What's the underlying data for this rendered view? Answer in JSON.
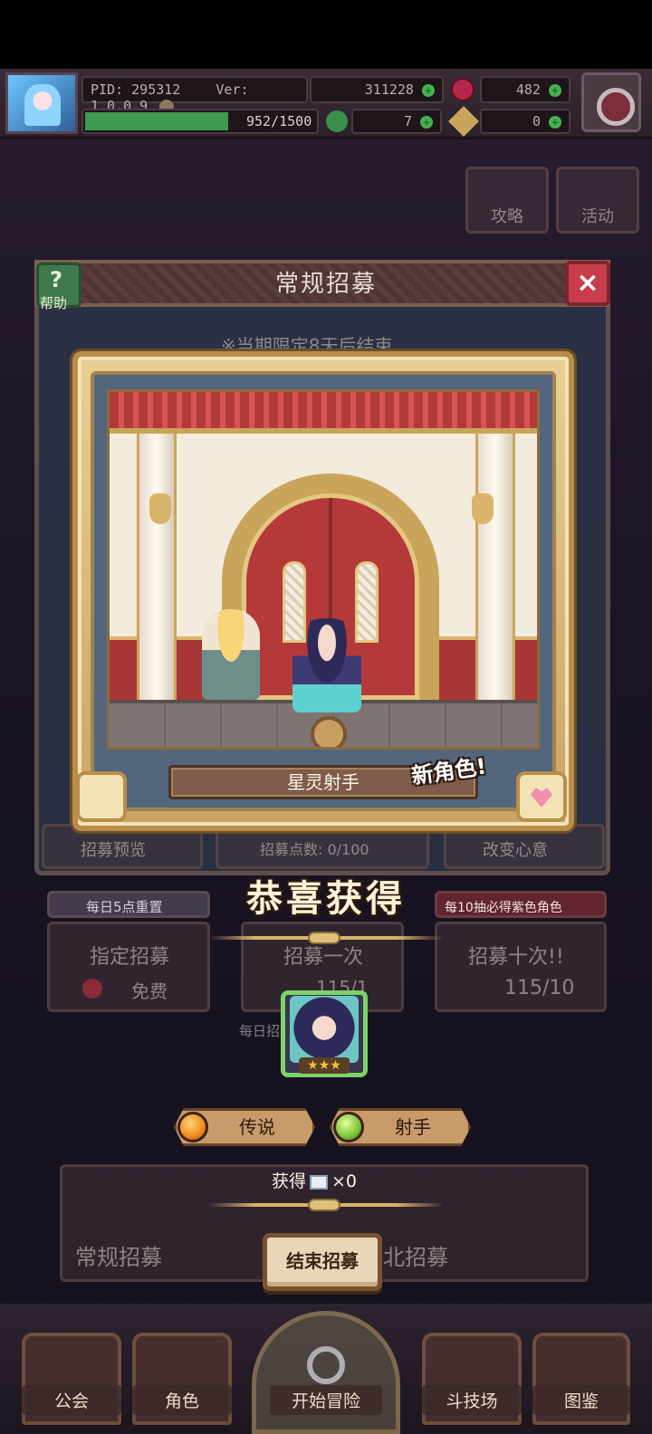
{
  "header": {
    "pid": "PID: 295312",
    "version": "Ver: 1.0.0.9",
    "coins": "311228",
    "gems": "482",
    "exp": "952/1500",
    "clover": "7",
    "keys": "0"
  },
  "background": {
    "dialog_title": "常规招募",
    "help_label": "帮助",
    "limited_notice": "※当期限定8天后结束",
    "side_labels": [
      "攻略",
      "活动"
    ],
    "preview_label": "招募预览",
    "points_label": "招募点数: 0/100",
    "change_label": "改变心意",
    "daily_reset": "每日5点重置",
    "guarantee": "每10抽必得紫色角色",
    "guarantee_highlight": "紫色",
    "designated": "指定招募",
    "free": "免费",
    "ten_pull": "招募十次!!",
    "ten_cost": "115/10",
    "one_pull": "招募一次",
    "one_cost": "115/1",
    "daily_limit": "每日招募 9999",
    "bottom_banner_left": "常规招募",
    "bottom_banner_right": "北招募"
  },
  "reward": {
    "character_name": "星灵射手",
    "new_tag": "新角色!",
    "congrats": "恭喜获得",
    "stars": "★★★",
    "rarity_tag": "传说",
    "class_tag": "射手",
    "obtain_label": "获得",
    "obtain_count": "×0",
    "end_button": "结束招募"
  },
  "nav": {
    "items": [
      "公会",
      "角色",
      "开始冒险",
      "斗技场",
      "图鉴"
    ]
  },
  "colors": {
    "gold": "#d8b46a",
    "red_close": "#c83d4b",
    "green_help": "#3f7a4c",
    "orange_gem": "#f08a1a",
    "green_gem": "#7fc23a"
  }
}
